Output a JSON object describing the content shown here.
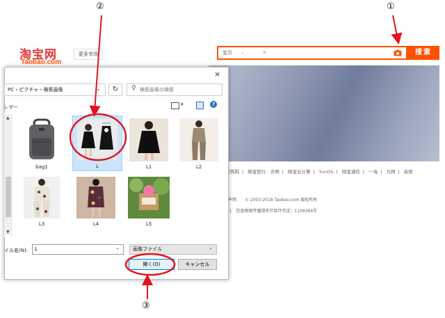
{
  "page": {
    "logo_cn": "淘宝网",
    "logo_en": "Taobao.com",
    "market_label": "更多市场",
    "search_category": "宝贝",
    "search_value": "a",
    "search_button": "搜索",
    "footer_links": [
      "网宝购购",
      "网宝旅行 - 去啊",
      "网宝云计算",
      "YunOS",
      "网宝通信",
      "一淘",
      "万网",
      "高德"
    ],
    "footer_line1": "法律声明　　© 2003-2018 Taobao.com 版权所有",
    "footer_line2": "224-1　信息网络传播视听节目许可证：1109364号"
  },
  "dialog": {
    "close": "×",
    "address": "PC › ピクチャ › 検索画像",
    "search_placeholder": "検索画像の検索",
    "toolbar_label": "レダー",
    "help": "?",
    "files": [
      {
        "name": "bag1"
      },
      {
        "name": "L"
      },
      {
        "name": "L1"
      },
      {
        "name": "L2"
      },
      {
        "name": "L3"
      },
      {
        "name": "L4"
      },
      {
        "name": "L5"
      }
    ],
    "filename_label": "イル名(N):",
    "filename_value": "L",
    "filetype_value": "画像ファイル",
    "open_button": "開く(O)",
    "cancel_button": "キャンセル"
  },
  "annotations": {
    "n1": "①",
    "n2": "②",
    "n3": "③",
    "color": "#e0141e"
  }
}
